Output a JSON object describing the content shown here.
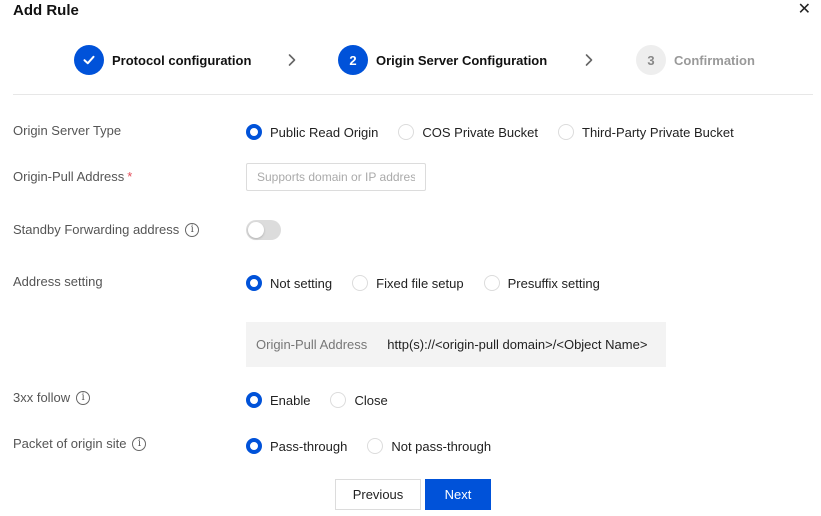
{
  "dialog": {
    "title": "Add Rule",
    "close_icon": "close-icon",
    "close_glyph": "✕"
  },
  "steps": [
    {
      "label": "Protocol configuration",
      "state": "done",
      "number": ""
    },
    {
      "label": "Origin Server Configuration",
      "state": "active",
      "number": "2"
    },
    {
      "label": "Confirmation",
      "state": "pending",
      "number": "3"
    }
  ],
  "form": {
    "origin_server_type": {
      "label": "Origin Server Type",
      "options": [
        "Public Read Origin",
        "COS Private Bucket",
        "Third-Party Private Bucket"
      ],
      "selected": "Public Read Origin"
    },
    "origin_pull_address": {
      "label": "Origin-Pull Address",
      "required_mark": "*",
      "value": "",
      "placeholder": "Supports domain or IP addres"
    },
    "standby_forwarding": {
      "label": "Standby Forwarding address",
      "info_glyph": "i",
      "enabled": false
    },
    "address_setting": {
      "label": "Address setting",
      "options": [
        "Not setting",
        "Fixed file setup",
        "Presuffix setting"
      ],
      "selected": "Not setting",
      "preview_key": "Origin-Pull Address",
      "preview_value": "http(s)://<origin-pull domain>/<Object Name>"
    },
    "follow_3xx": {
      "label": "3xx follow",
      "info_glyph": "i",
      "options": [
        "Enable",
        "Close"
      ],
      "selected": "Enable"
    },
    "packet_origin": {
      "label": "Packet of origin site",
      "info_glyph": "i",
      "options": [
        "Pass-through",
        "Not pass-through"
      ],
      "selected": "Pass-through"
    }
  },
  "footer": {
    "previous_label": "Previous",
    "next_label": "Next"
  },
  "colors": {
    "primary": "#0052d9",
    "required": "#e34d59",
    "pending_step": "#eeeeee"
  }
}
